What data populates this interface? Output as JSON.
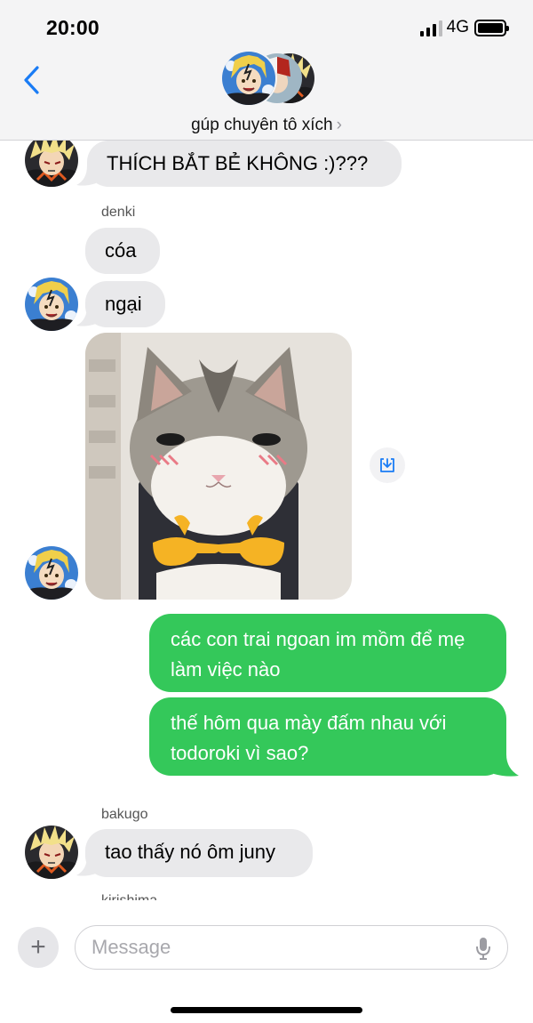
{
  "status_bar": {
    "time": "20:00",
    "network": "4G"
  },
  "header": {
    "group_name": "gúp chuyên tô xích",
    "chevron": "›"
  },
  "messages": [
    {
      "sender": "",
      "text": "THÍCH BẮT BẺ KHÔNG :)???"
    },
    {
      "sender": "denki",
      "text": "cóa"
    },
    {
      "sender": "",
      "text": "ngại"
    },
    {
      "sender": "",
      "image": "cat-pointing-fingers-image"
    },
    {
      "sender": "me",
      "text": "các con trai ngoan im mồm để mẹ làm việc nào"
    },
    {
      "sender": "me",
      "text": "thế hôm qua mày đấm nhau với todoroki vì sao?"
    },
    {
      "sender": "bakugo",
      "text": "tao thấy nó ôm juny"
    },
    {
      "sender": "kirishima",
      "text": ""
    }
  ],
  "composer": {
    "placeholder": "Message",
    "plus": "+"
  },
  "icons": {
    "back": "chevron-left-icon",
    "save": "download-icon",
    "mic": "microphone-icon",
    "plus": "plus-icon"
  },
  "colors": {
    "accent": "#1a7cf5",
    "outgoing_bubble": "#34c85a",
    "incoming_bubble": "#e9e9eb"
  }
}
